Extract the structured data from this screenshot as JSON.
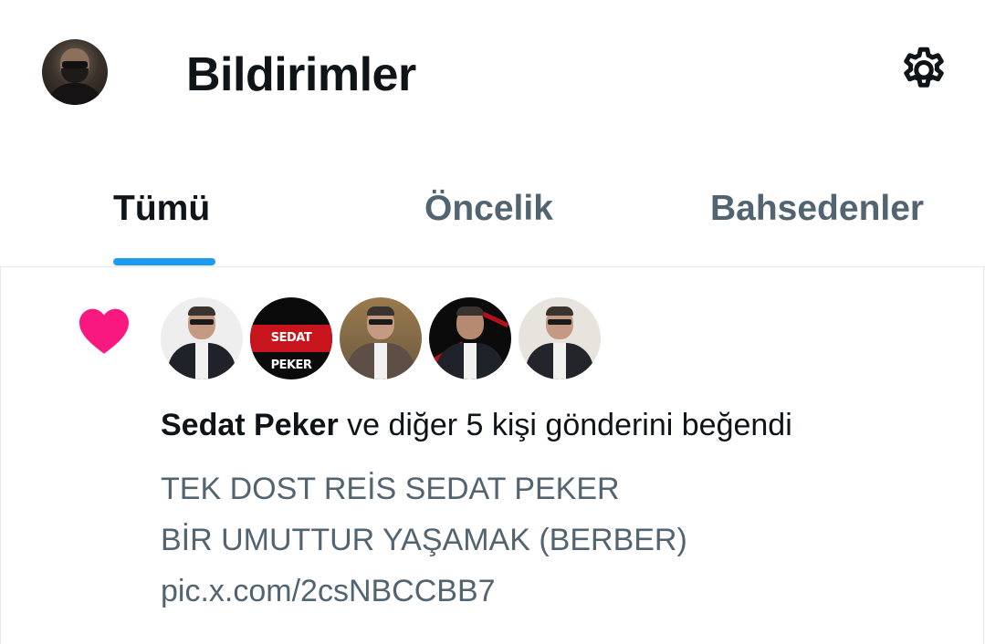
{
  "header": {
    "title": "Bildirimler",
    "avatar_icon": "profile-avatar",
    "settings_icon": "gear-icon"
  },
  "tabs": [
    {
      "label": "Tümü",
      "active": true
    },
    {
      "label": "Öncelik",
      "active": false
    },
    {
      "label": "Bahsedenler",
      "active": false
    }
  ],
  "colors": {
    "accent": "#1d9bf0",
    "like": "#f91880",
    "text_primary": "#0f1419",
    "text_secondary": "#536471"
  },
  "notification": {
    "type_icon": "heart-icon",
    "avatar_logo_text": "SEDAT PEKER",
    "actor": "Sedat Peker",
    "action": " ve diğer 5 kişi gönderini beğendi",
    "tweet_lines": [
      "TEK DOST REİS SEDAT PEKER",
      "BİR UMUTTUR YAŞAMAK (BERBER)",
      "pic.x.com/2csNBCCBB7"
    ]
  }
}
